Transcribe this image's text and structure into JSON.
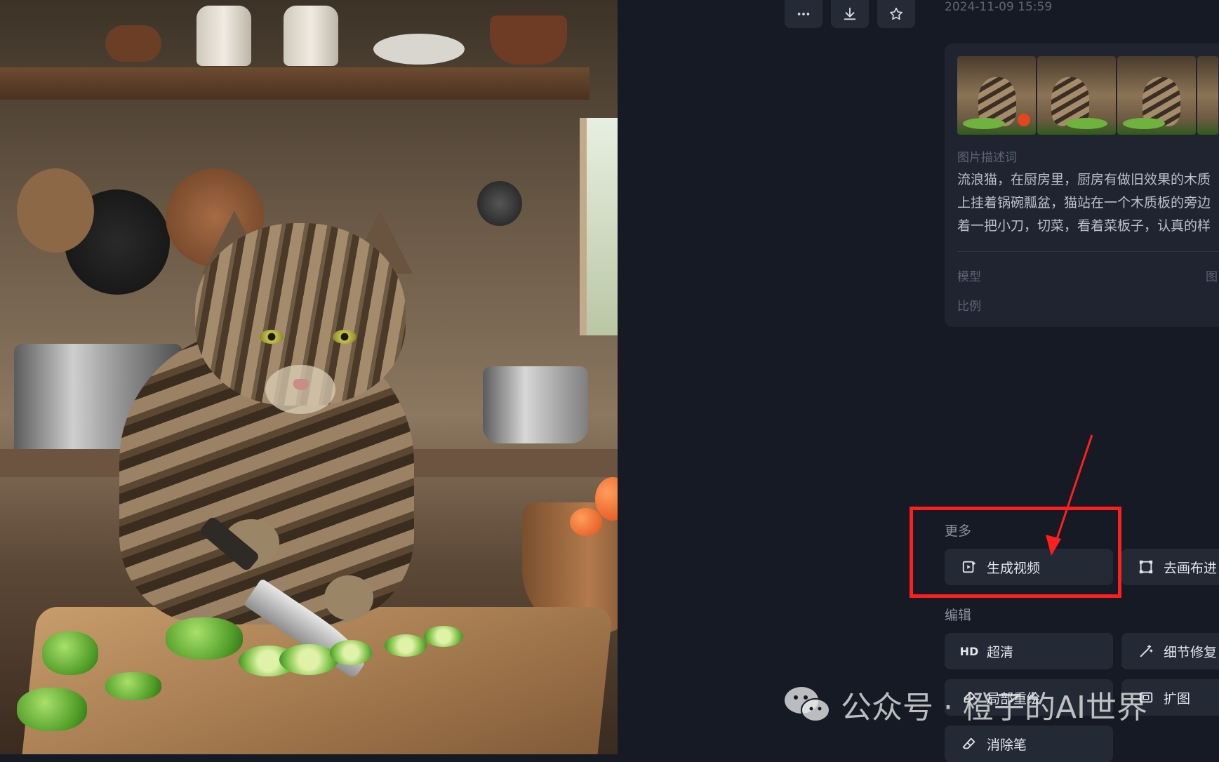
{
  "toolbar": {
    "more_icon": "more-icon",
    "download_icon": "download-icon",
    "favorite_icon": "star-icon",
    "timestamp": "2024-11-09 15:59"
  },
  "info_card": {
    "prompt_label": "图片描述词",
    "prompt_lines": [
      "流浪猫，在厨房里，厨房有做旧效果的木质",
      "上挂着锅碗瓢盆，猫站在一个木质板的旁边",
      "着一把小刀，切菜，看着菜板子，认真的样"
    ],
    "model_label": "模型",
    "model_value": "图",
    "ratio_label": "比例"
  },
  "more_section": {
    "title": "更多",
    "buttons": [
      {
        "label": "生成视频",
        "icon": "video-icon"
      },
      {
        "label": "去画布进",
        "icon": "canvas-icon"
      }
    ]
  },
  "edit_section": {
    "title": "编辑",
    "buttons": [
      {
        "label": "超清",
        "icon_text": "HD"
      },
      {
        "label": "细节修复",
        "icon": "magic-wand-icon"
      },
      {
        "label": "局部重绘",
        "icon": "brush-icon"
      },
      {
        "label": "扩图",
        "icon": "expand-icon"
      },
      {
        "label": "消除笔",
        "icon": "eraser-icon"
      }
    ]
  },
  "annotation": {
    "box_color": "#ff1f1f"
  },
  "watermark": {
    "text": "公众号 · 橙子的AI世界"
  }
}
